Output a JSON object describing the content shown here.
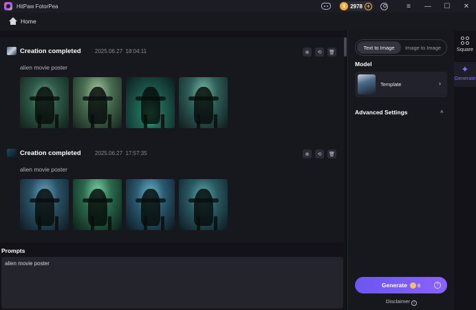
{
  "app": {
    "title": "HitPaw FotorPea",
    "coins": "2978"
  },
  "titlebar": {
    "minimize": "—",
    "maximize": "☐",
    "close": "✕",
    "menu": "≡"
  },
  "nav": {
    "home": "Home"
  },
  "creations": [
    {
      "title": "Creation completed",
      "date": "2025.06.27",
      "time": "18:04:11",
      "prompt": "alien movie poster"
    },
    {
      "title": "Creation completed",
      "date": "2025.06.27",
      "time": "17:57:35",
      "prompt": "alien movie poster"
    }
  ],
  "prompts": {
    "label": "Prompts",
    "value": "alien movie poster"
  },
  "panel": {
    "modes": [
      "Text to Image",
      "Image to Image"
    ],
    "active_mode": "Text to Image",
    "model_label": "Model",
    "model_name": "Template",
    "advanced_label": "Advanced Settings",
    "generate_label": "Generate",
    "generate_cost": "8",
    "disclaimer": "Disclaimer"
  },
  "rail": {
    "square": "Square",
    "generate": "Generate"
  },
  "colors": {
    "accent": "#7b5cff",
    "coin": "#f2a93b",
    "background": "#121218"
  }
}
